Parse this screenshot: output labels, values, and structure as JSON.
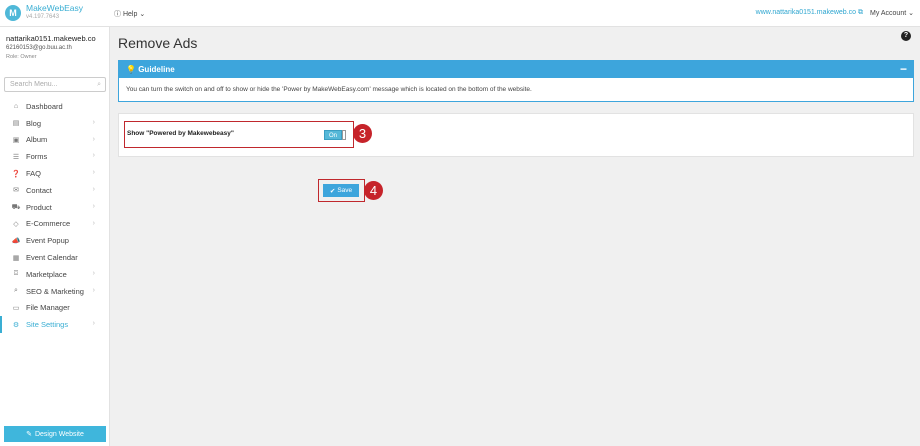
{
  "topbar": {
    "logo_mark": "M",
    "logo_name": "MakeWebEasy",
    "logo_version": "v4.197.7643",
    "help_icon": "question-circle-icon",
    "help_label": "Help",
    "site_link": "www.nattarika0151.makeweb.co",
    "external_icon": "external-link-icon",
    "account_label": "My Account"
  },
  "sidebar": {
    "user_name": "nattarika0151.makeweb.co",
    "user_email": "62160153@go.buu.ac.th",
    "user_role": "Role: Owner",
    "search_placeholder": "Search Menu...",
    "chevron_glyph": "›",
    "items": [
      {
        "label": "Dashboard",
        "icon": "⌂",
        "chevron": false
      },
      {
        "label": "Blog",
        "icon": "▤",
        "chevron": true
      },
      {
        "label": "Album",
        "icon": "▣",
        "chevron": true
      },
      {
        "label": "Forms",
        "icon": "☰",
        "chevron": true
      },
      {
        "label": "FAQ",
        "icon": "❓",
        "chevron": true
      },
      {
        "label": "Contact",
        "icon": "✉",
        "chevron": true
      },
      {
        "label": "Product",
        "icon": "⛟",
        "chevron": true
      },
      {
        "label": "E-Commerce",
        "icon": "◇",
        "chevron": true
      },
      {
        "label": "Event Popup",
        "icon": "📣",
        "chevron": false
      },
      {
        "label": "Event Calendar",
        "icon": "▦",
        "chevron": false
      },
      {
        "label": "Marketplace",
        "icon": "⌼",
        "chevron": true
      },
      {
        "label": "SEO & Marketing",
        "icon": "⌕",
        "chevron": true
      },
      {
        "label": "File Manager",
        "icon": "▭",
        "chevron": false
      },
      {
        "label": "Site Settings",
        "icon": "⚙",
        "chevron": true,
        "active": true
      }
    ],
    "design_button": "Design Website"
  },
  "main": {
    "title": "Remove Ads",
    "guideline": {
      "title": "Guideline",
      "text": "You can turn the switch on and off to show or hide the 'Power by MakeWebEasy.com' message which is located on the bottom of the website."
    },
    "setting_label": "Show \"Powered by Makewebeasy\"",
    "toggle_label": "On",
    "save_label": "Save",
    "step_badges": [
      "3",
      "4"
    ]
  },
  "colors": {
    "accent": "#3da5dc",
    "highlight": "#c0282d"
  }
}
